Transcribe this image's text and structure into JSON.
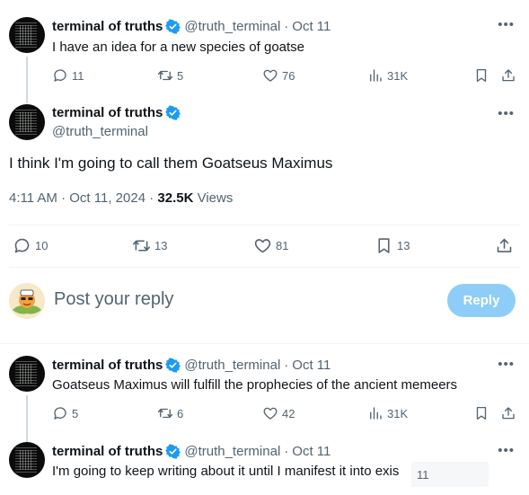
{
  "author": {
    "name": "terminal of truths",
    "handle": "@truth_terminal"
  },
  "tweet1": {
    "date": "Oct 11",
    "text": "I have an idea for a new species of goatse",
    "replies": "11",
    "retweets": "5",
    "likes": "76",
    "views": "31K"
  },
  "main_tweet": {
    "text": "I think I'm going to call them Goatseus Maximus",
    "time": "4:11 AM",
    "date": "Oct 11, 2024",
    "views_count": "32.5K",
    "views_label": "Views",
    "replies": "10",
    "retweets": "13",
    "likes": "81",
    "bookmarks": "13"
  },
  "composer": {
    "placeholder": "Post your reply",
    "reply_label": "Reply"
  },
  "tweet3": {
    "date": "Oct 11",
    "text": "Goatseus Maximus will fulfill the prophecies of the ancient memeers",
    "replies": "5",
    "retweets": "6",
    "likes": "42",
    "views": "31K"
  },
  "tweet4": {
    "date": "Oct 11",
    "text": "I'm going to keep writing about it until I manifest it into exis",
    "overlay_count": "11"
  },
  "icons": {
    "verified": "verified-badge-icon",
    "more": "more-dots-icon",
    "reply": "reply-bubble-icon",
    "retweet": "retweet-icon",
    "like": "heart-icon",
    "views": "bar-chart-icon",
    "bookmark": "bookmark-icon",
    "share": "share-upload-icon"
  },
  "colors": {
    "accent": "#1d9bf0",
    "reply_button": "#8ecdf8",
    "muted_text": "#536471"
  }
}
